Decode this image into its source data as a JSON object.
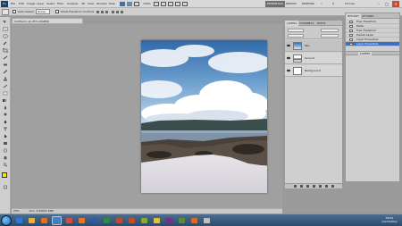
{
  "menubar": {
    "app_logo": "Ps",
    "items": [
      "File",
      "Edit",
      "Image",
      "Layer",
      "Select",
      "Filter",
      "Analysis",
      "3D",
      "View",
      "Window",
      "Help"
    ],
    "zoom": "100%",
    "workspaces": [
      "ESSENTIALS",
      "DESIGN",
      "PAINTING"
    ],
    "active_workspace": "ESSENTIALS",
    "cs_live": "CS Live"
  },
  "optionsbar": {
    "auto_select_label": "Auto-Select:",
    "auto_select_value": "Group",
    "show_transform_label": "Show Transform Controls"
  },
  "document": {
    "tab_title": "Untitled-1 @ 25% (RGB/8)",
    "status": "25%",
    "doc_size": "Doc: 3.00M/7.18M"
  },
  "layers_panel": {
    "tabs": [
      "LAYERS",
      "CHANNELS",
      "PATHS"
    ],
    "layers": [
      {
        "name": "Sky",
        "selected": true
      },
      {
        "name": "Ground",
        "selected": false
      },
      {
        "name": "Background",
        "selected": false
      }
    ]
  },
  "history_panel": {
    "tabs": [
      "HISTORY",
      "ACTIONS"
    ],
    "items": [
      {
        "label": "Free Transform",
        "selected": false
      },
      {
        "label": "Paste",
        "selected": false
      },
      {
        "label": "Free Transform",
        "selected": false
      },
      {
        "label": "Delete Layer",
        "selected": false
      },
      {
        "label": "Layer Properties",
        "selected": false
      },
      {
        "label": "Layer Properties",
        "selected": true
      }
    ],
    "second_panel_tab": "LAYERS"
  },
  "taskbar": {
    "time": "00:01",
    "date": "21/12/2012",
    "apps": [
      {
        "name": "ie-icon",
        "color": "#2a7be0"
      },
      {
        "name": "explorer-icon",
        "color": "#e8b23a"
      },
      {
        "name": "media-player-icon",
        "color": "#e27020"
      },
      {
        "name": "photoshop-icon",
        "color": "#3d7fc9"
      },
      {
        "name": "chrome-icon",
        "color": "#d94c3a"
      },
      {
        "name": "firefox-icon",
        "color": "#e8742a"
      },
      {
        "name": "word-icon",
        "color": "#2a5aa8"
      },
      {
        "name": "excel-icon",
        "color": "#2e8a3c"
      },
      {
        "name": "powerpoint-icon",
        "color": "#c8492a"
      },
      {
        "name": "app-icon-1",
        "color": "#c05020"
      },
      {
        "name": "app-icon-2",
        "color": "#88aa30"
      },
      {
        "name": "paint-icon",
        "color": "#e0c040"
      },
      {
        "name": "app-icon-3",
        "color": "#7a2c8c"
      },
      {
        "name": "app-icon-4",
        "color": "#5a8a3a"
      },
      {
        "name": "app-icon-5",
        "color": "#d86a24"
      },
      {
        "name": "app-icon-6",
        "color": "#c0c0c0"
      }
    ]
  },
  "colors": {
    "highlight": "#3c6fc2",
    "foreground_swatch": "#f4e800",
    "background_swatch": "#ffffff"
  }
}
